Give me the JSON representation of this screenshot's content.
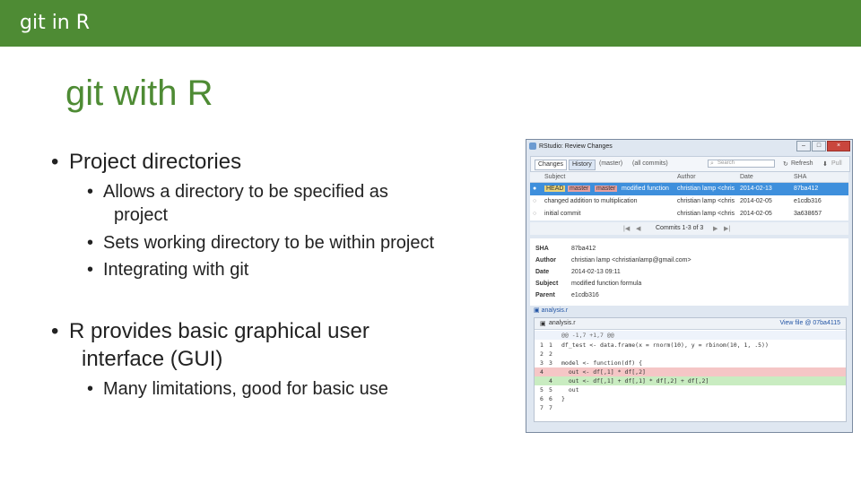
{
  "header": {
    "title": "git in R"
  },
  "slide": {
    "title": "git with R",
    "bullets": [
      {
        "text": "Project directories",
        "sub": [
          "Allows a directory to be specified as",
          "project",
          "Sets working directory to be within project",
          "Integrating with git"
        ]
      },
      {
        "text": "R provides basic graphical user",
        "text2": "interface (GUI)",
        "sub": [
          "Many limitations, good for basic use"
        ]
      }
    ]
  },
  "window": {
    "title": "RStudio: Review Changes",
    "toolbar": {
      "changes_tab": "Changes",
      "history_tab": "History",
      "branch": "(master)",
      "commit_filter": "(all commits)",
      "search_placeholder": "Search",
      "refresh": "Refresh",
      "pull": "Pull"
    },
    "columns": {
      "subject": "Subject",
      "author": "Author",
      "date": "Date",
      "sha": "SHA"
    },
    "commits": [
      {
        "tag1": "HEAD",
        "tag2": "master",
        "tag3": "master",
        "subject": "modified function",
        "author": "christian lamp <chris",
        "date": "2014-02-13",
        "sha": "87ba412"
      },
      {
        "subject": "changed addition to multiplication",
        "author": "christian lamp <chris",
        "date": "2014-02-05",
        "sha": "e1cdb316"
      },
      {
        "subject": "initial commit",
        "author": "christian lamp <chris",
        "date": "2014-02-05",
        "sha": "3a638657"
      }
    ],
    "pager": "Commits 1-3 of 3",
    "meta": {
      "sha": {
        "k": "SHA",
        "v": "87ba412"
      },
      "author": {
        "k": "Author",
        "v": "christian lamp <christianlamp@gmail.com>"
      },
      "date": {
        "k": "Date",
        "v": "2014-02-13 09:11"
      },
      "subject": {
        "k": "Subject",
        "v": "modified function formula"
      },
      "parent": {
        "k": "Parent",
        "v": "e1cdb316"
      }
    },
    "file_link": "analysis.r",
    "diff": {
      "file": "analysis.r",
      "view_file": "View file @ 07ba4115",
      "hunk": "@@ -1,7 +1,7 @@",
      "lines": [
        {
          "n1": "1",
          "n2": "1",
          "code": "df_test <- data.frame(x = rnorm(10), y = rbinom(10, 1, .5))",
          "kind": "ctx"
        },
        {
          "n1": "2",
          "n2": "2",
          "code": "",
          "kind": "ctx"
        },
        {
          "n1": "3",
          "n2": "3",
          "code": "model <- function(df) {",
          "kind": "ctx"
        },
        {
          "n1": "4",
          "n2": "",
          "code": "  out <- df[,1] * df[,2]",
          "kind": "del"
        },
        {
          "n1": "",
          "n2": "4",
          "code": "  out <- df[,1] + df[,1] * df[,2] + df[,2]",
          "kind": "add"
        },
        {
          "n1": "5",
          "n2": "5",
          "code": "  out",
          "kind": "ctx"
        },
        {
          "n1": "6",
          "n2": "6",
          "code": "}",
          "kind": "ctx"
        },
        {
          "n1": "7",
          "n2": "7",
          "code": "",
          "kind": "ctx"
        }
      ]
    }
  }
}
